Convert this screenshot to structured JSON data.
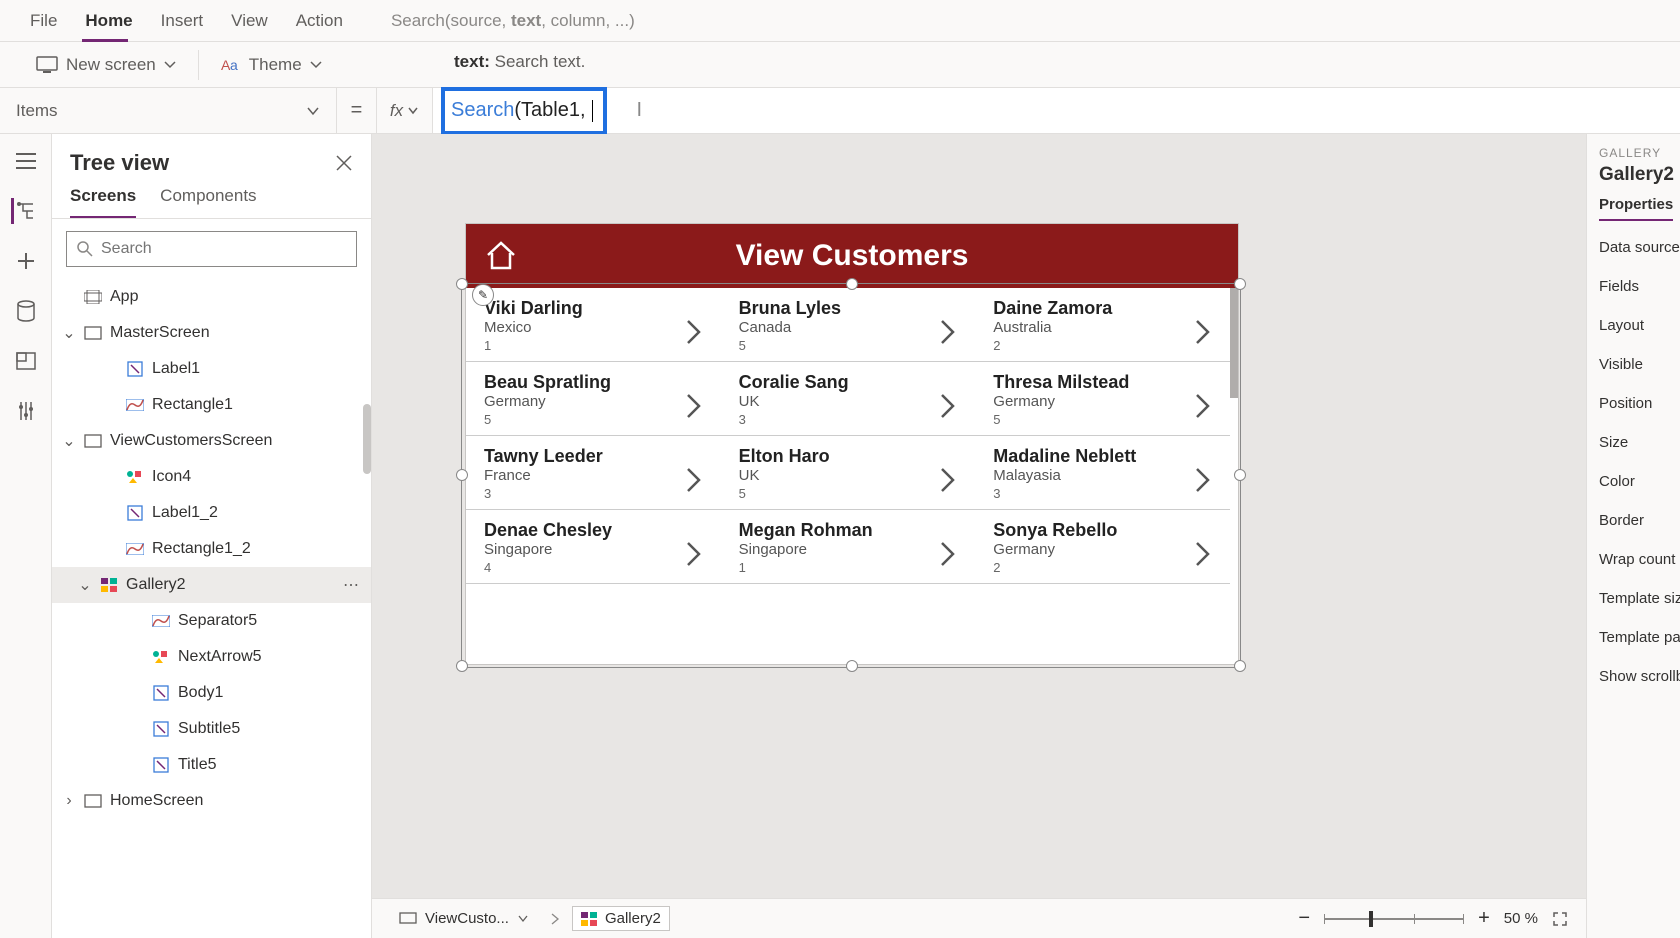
{
  "ribbon": {
    "tabs": [
      "File",
      "Home",
      "Insert",
      "View",
      "Action"
    ],
    "active": "Home"
  },
  "formula_hint_prefix": "Search(source, ",
  "formula_hint_bold": "text",
  "formula_hint_suffix": ", column, ...)",
  "toolbar": {
    "new_screen": "New screen",
    "theme": "Theme",
    "help_label": "text:",
    "help_text": " Search text."
  },
  "prop_selector": "Items",
  "eq": "=",
  "fx": "fx",
  "formula": {
    "fn": "Search",
    "rest": "(Table1, "
  },
  "tree": {
    "title": "Tree view",
    "tabs": [
      "Screens",
      "Components"
    ],
    "search_placeholder": "Search",
    "nodes": [
      {
        "label": "App",
        "indent": 0,
        "icon": "app"
      },
      {
        "label": "MasterScreen",
        "indent": 0,
        "icon": "screen",
        "chev": "v"
      },
      {
        "label": "Label1",
        "indent": 2,
        "icon": "label"
      },
      {
        "label": "Rectangle1",
        "indent": 2,
        "icon": "rect"
      },
      {
        "label": "ViewCustomersScreen",
        "indent": 0,
        "icon": "screen",
        "chev": "v"
      },
      {
        "label": "Icon4",
        "indent": 2,
        "icon": "icon"
      },
      {
        "label": "Label1_2",
        "indent": 2,
        "icon": "label"
      },
      {
        "label": "Rectangle1_2",
        "indent": 2,
        "icon": "rect"
      },
      {
        "label": "Gallery2",
        "indent": 1,
        "icon": "gallery",
        "chev": "v",
        "sel": true,
        "dots": true
      },
      {
        "label": "Separator5",
        "indent": 3,
        "icon": "rect"
      },
      {
        "label": "NextArrow5",
        "indent": 3,
        "icon": "icon"
      },
      {
        "label": "Body1",
        "indent": 3,
        "icon": "label"
      },
      {
        "label": "Subtitle5",
        "indent": 3,
        "icon": "label"
      },
      {
        "label": "Title5",
        "indent": 3,
        "icon": "label"
      },
      {
        "label": "HomeScreen",
        "indent": 0,
        "icon": "screen",
        "chev": ">"
      }
    ]
  },
  "preview": {
    "title": "View Customers",
    "rows": [
      [
        {
          "name": "Viki  Darling",
          "sub": "Mexico",
          "num": "1"
        },
        {
          "name": "Bruna  Lyles",
          "sub": "Canada",
          "num": "5"
        },
        {
          "name": "Daine  Zamora",
          "sub": "Australia",
          "num": "2"
        }
      ],
      [
        {
          "name": "Beau  Spratling",
          "sub": "Germany",
          "num": "5"
        },
        {
          "name": "Coralie  Sang",
          "sub": "UK",
          "num": "3"
        },
        {
          "name": "Thresa  Milstead",
          "sub": "Germany",
          "num": "5"
        }
      ],
      [
        {
          "name": "Tawny  Leeder",
          "sub": "France",
          "num": "3"
        },
        {
          "name": "Elton  Haro",
          "sub": "UK",
          "num": "5"
        },
        {
          "name": "Madaline  Neblett",
          "sub": "Malayasia",
          "num": "3"
        }
      ],
      [
        {
          "name": "Denae  Chesley",
          "sub": "Singapore",
          "num": "4"
        },
        {
          "name": "Megan  Rohman",
          "sub": "Singapore",
          "num": "1"
        },
        {
          "name": "Sonya  Rebello",
          "sub": "Germany",
          "num": "2"
        }
      ]
    ]
  },
  "breadcrumb": {
    "screen": "ViewCusto...",
    "ctrl": "Gallery2"
  },
  "props": {
    "section": "GALLERY",
    "name": "Gallery2",
    "tab": "Properties",
    "items": [
      "Data source",
      "Fields",
      "Layout",
      "Visible",
      "Position",
      "Size",
      "Color",
      "Border",
      "Wrap count",
      "Template size",
      "Template padding"
    ],
    "scroll_label": "Show scrollbar"
  },
  "zoom": {
    "value": "50",
    "pct": "%"
  }
}
